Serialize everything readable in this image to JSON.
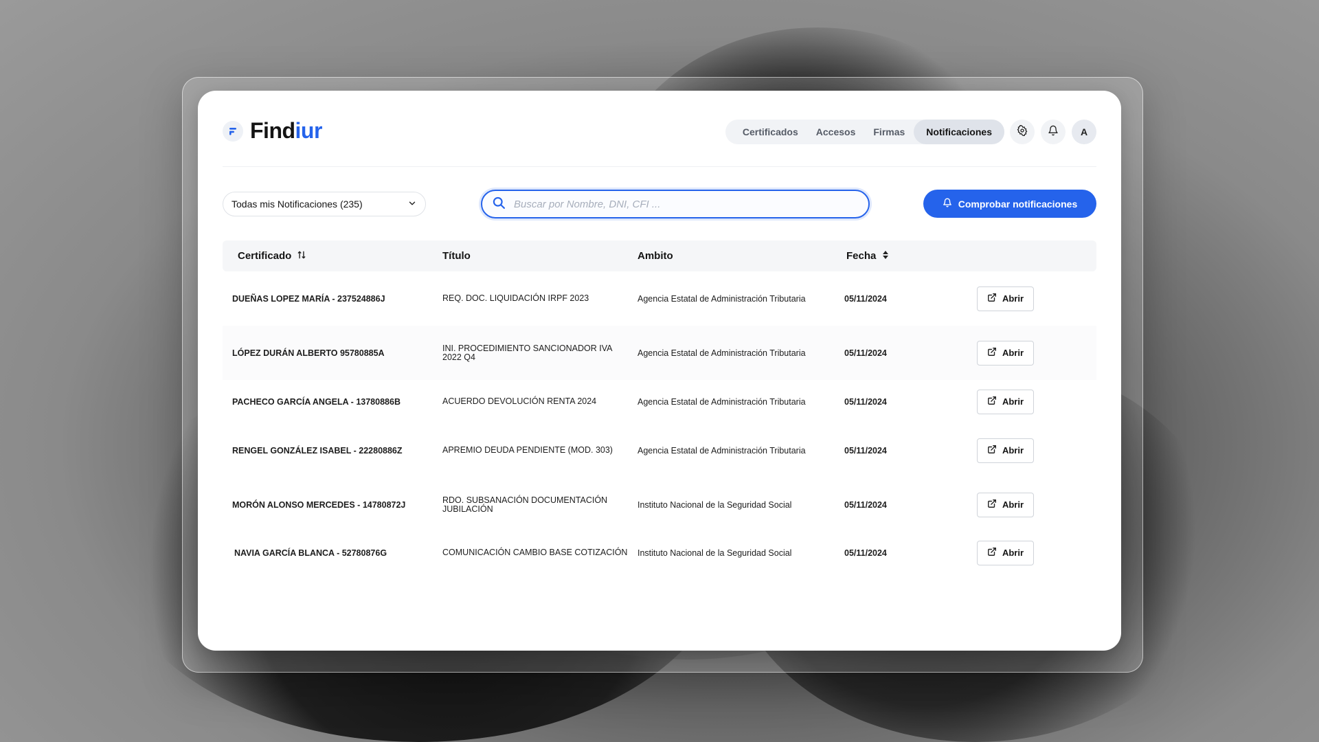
{
  "brand": {
    "name_prefix": "Find",
    "name_accent": "iur",
    "accent_color": "#2563eb"
  },
  "nav": {
    "items": [
      "Certificados",
      "Accesos",
      "Firmas",
      "Notificaciones"
    ],
    "active": "Notificaciones"
  },
  "header_icons": [
    "gear-icon",
    "bell-icon"
  ],
  "user": {
    "avatar_initial": "A"
  },
  "filter": {
    "selected": "Todas mis Notificaciones (235)"
  },
  "search": {
    "placeholder": "Buscar por Nombre, DNI, CFI ..."
  },
  "actions": {
    "check_label": "Comprobar notificaciones"
  },
  "table": {
    "columns": {
      "certificado": "Certificado",
      "titulo": "Título",
      "ambito": "Ambito",
      "fecha": "Fecha"
    },
    "open_label": "Abrir",
    "rows": [
      {
        "certificado": "DUEÑAS LOPEZ MARÍA - 237524886J",
        "titulo": "REQ. DOC. LIQUIDACIÓN IRPF 2023",
        "ambito": "Agencia Estatal de Administración Tributaria",
        "fecha": "05/11/2024"
      },
      {
        "certificado": "LÓPEZ DURÁN ALBERTO 95780885A",
        "titulo": "INI. PROCEDIMIENTO SANCIONADOR IVA 2022 Q4",
        "ambito": "Agencia Estatal de Administración Tributaria",
        "fecha": "05/11/2024"
      },
      {
        "certificado": "PACHECO GARCÍA ANGELA - 13780886B",
        "titulo": "ACUERDO DEVOLUCIÓN RENTA 2024",
        "ambito": "Agencia Estatal de Administración Tributaria",
        "fecha": "05/11/2024"
      },
      {
        "certificado": "RENGEL GONZÁLEZ ISABEL - 22280886Z",
        "titulo": "APREMIO DEUDA PENDIENTE (MOD. 303)",
        "ambito": "Agencia Estatal de Administración Tributaria",
        "fecha": "05/11/2024"
      },
      {
        "certificado": "MORÓN ALONSO MERCEDES - 14780872J",
        "titulo": "RDO. SUBSANACIÓN DOCUMENTACIÓN JUBILACIÓN",
        "ambito": "Instituto Nacional de la Seguridad Social",
        "fecha": "05/11/2024"
      },
      {
        "certificado": "NAVIA GARCÍA BLANCA - 52780876G",
        "titulo": "COMUNICACIÓN CAMBIO BASE COTIZACIÓN",
        "ambito": "Instituto Nacional de la Seguridad Social",
        "fecha": "05/11/2024"
      }
    ]
  }
}
